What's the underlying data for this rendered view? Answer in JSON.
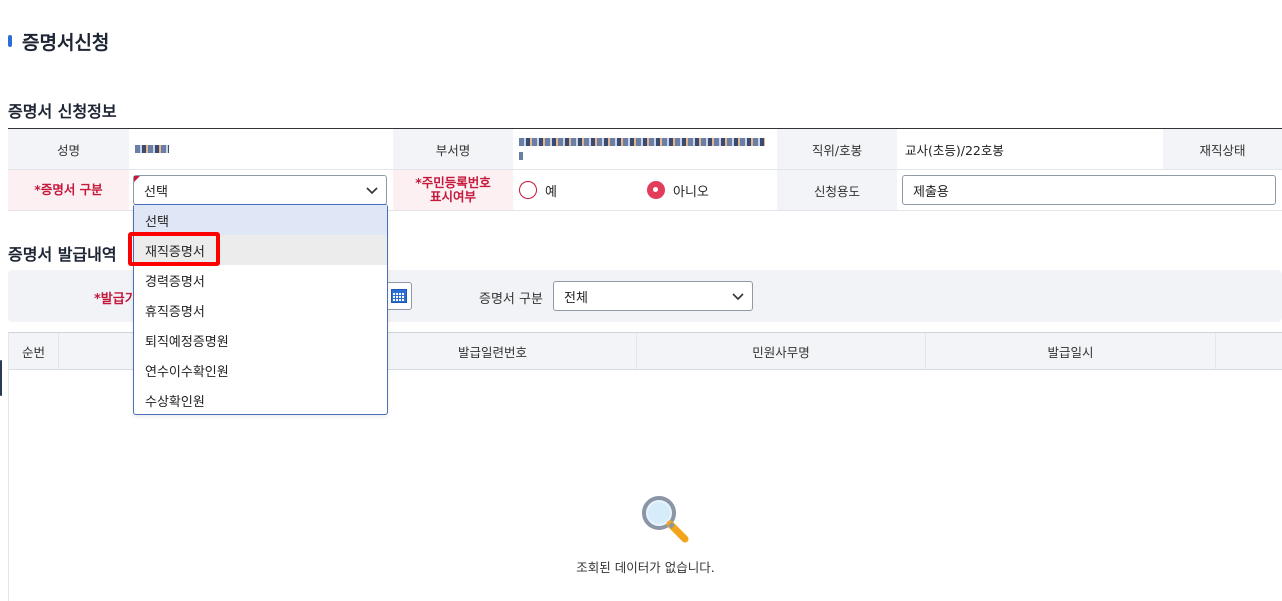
{
  "page_title": "증명서신청",
  "apply_section": {
    "title": "증명서 신청정보",
    "name_label": "성명",
    "dept_label": "부서명",
    "position_label": "직위/호봉",
    "position_value": "교사(초등)/22호봉",
    "status_label": "재직상태",
    "cert_type_label": "*증명서 구분",
    "cert_type_value": "선택",
    "resident_label_line1": "*주민등록번호",
    "resident_label_line2": "표시여부",
    "radio_yes": "예",
    "radio_no": "아니오",
    "radio_selected": "아니오",
    "purpose_label": "신청용도",
    "purpose_value": "제출용"
  },
  "dropdown": {
    "options": [
      "선택",
      "재직증명서",
      "경력증명서",
      "휴직증명서",
      "퇴직예정증명원",
      "연수이수확인원",
      "수상확인원"
    ],
    "selected": "선택",
    "highlighted": "재직증명서"
  },
  "history_section": {
    "title": "증명서 발급내역",
    "issue_period_label": "*발급기",
    "cert_kind_label": "증명서 구분",
    "cert_kind_value": "전체",
    "columns": [
      "순번",
      "발급일련번호",
      "민원사무명",
      "발급일시"
    ],
    "empty_message": "조회된 데이터가 없습니다."
  },
  "colors": {
    "accent": "#2b6fd6",
    "required": "#c4183c",
    "highlight_box": "#ff0000"
  },
  "icons": {
    "calendar": "calendar-icon",
    "search": "magnifier-icon",
    "dropdown": "chevron-down-icon"
  }
}
